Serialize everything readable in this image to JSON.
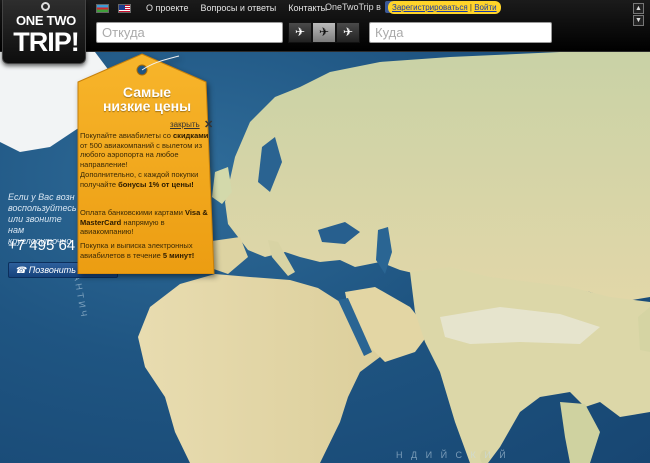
{
  "header": {
    "logo": {
      "line1": "ONE TWO",
      "line2": "TRIP!"
    },
    "languages": [
      "az-flag",
      "us-flag"
    ],
    "nav": [
      "О проекте",
      "Вопросы и ответы",
      "Контакты"
    ],
    "social_label": "OneTwoTrip в",
    "auth": {
      "register": "Зарегистрироваться",
      "separator": " | ",
      "login": "Войти"
    },
    "search": {
      "from_placeholder": "Откуда",
      "to_placeholder": "Куда",
      "modes": [
        "plane-icon",
        "plane-multi-icon",
        "plane-return-icon"
      ]
    }
  },
  "left_panel": {
    "lines": [
      "Если у Вас возн",
      "воспользуйтесь",
      "или звоните нам",
      "круглосуточно"
    ],
    "phone": "+7 495 64",
    "call_button": "Позвонить"
  },
  "promo_tag": {
    "title_line1": "Самые",
    "title_line2": "низкие цены",
    "close": "закрыть",
    "paragraphs": [
      {
        "pre": "Покупайте авиабилеты со ",
        "bold": "скидками",
        "post": " от 500 авиакомпаний с вылетом из любого аэропорта на любое направление!"
      },
      {
        "pre": "Дополнительно, с каждой покупки получайте ",
        "bold": "бонусы 1% от цены!",
        "post": ""
      },
      {
        "pre": "Оплата банковскими картами ",
        "bold": "Visa & MasterCard",
        "post": " напрямую в авиакомпанию!"
      },
      {
        "pre": "Покупка и выписка электронных авиабилетов в течение ",
        "bold": "5 минут!",
        "post": ""
      }
    ]
  },
  "map": {
    "labels": [
      "АНТИЧ",
      "Н Д И Й С К И Й"
    ]
  },
  "colors": {
    "ocean": "#1f5582",
    "land": "#d9d6a8",
    "tag": "#f2a91c",
    "auth": "#ffd42a"
  }
}
